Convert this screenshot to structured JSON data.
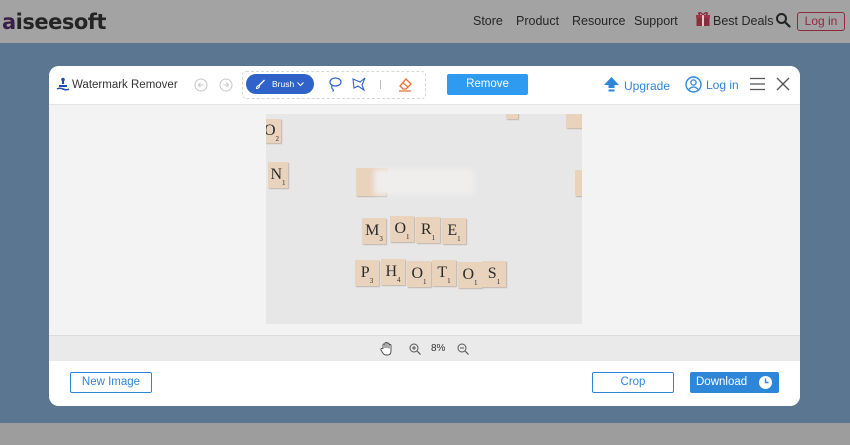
{
  "site": {
    "logo_initial": "a",
    "logo_rest": "iseesoft",
    "nav": [
      {
        "label": "Store"
      },
      {
        "label": "Product"
      },
      {
        "label": "Resource"
      },
      {
        "label": "Support"
      },
      {
        "label": "Best Deals"
      }
    ],
    "login_label": "Log in"
  },
  "modal": {
    "title": "Watermark Remover",
    "brush_label": "Brush",
    "remove_label": "Remove",
    "upgrade_label": "Upgrade",
    "login_label": "Log in",
    "zoom": "8%",
    "new_image_label": "New Image",
    "crop_label": "Crop",
    "download_label": "Download"
  },
  "photo": {
    "row1": [
      {
        "letter": "M",
        "sub": "3"
      },
      {
        "letter": "O",
        "sub": "1"
      },
      {
        "letter": "R",
        "sub": "1"
      },
      {
        "letter": "E",
        "sub": "1"
      }
    ],
    "row2": [
      {
        "letter": "P",
        "sub": "3"
      },
      {
        "letter": "H",
        "sub": "4"
      },
      {
        "letter": "O",
        "sub": "1"
      },
      {
        "letter": "T",
        "sub": "1"
      },
      {
        "letter": "O",
        "sub": "1"
      },
      {
        "letter": "S",
        "sub": "1"
      }
    ],
    "edge_tiles": [
      {
        "letter": "O",
        "sub": "2"
      },
      {
        "letter": "N",
        "sub": "1"
      }
    ]
  },
  "colors": {
    "accent_blue": "#2e86d8",
    "brush_blue": "#2f63c9",
    "remove_blue": "#2e9bf0",
    "login_red": "#8b2c3e",
    "tile": "#e9d3bd"
  },
  "icons": [
    "gift-icon",
    "search-icon",
    "watermark-app-icon",
    "undo-icon",
    "redo-icon",
    "brush-icon",
    "lasso-icon",
    "polygon-lasso-icon",
    "eraser-icon",
    "upgrade-icon",
    "user-icon",
    "menu-icon",
    "close-icon",
    "hand-icon",
    "zoom-in-icon",
    "zoom-out-icon",
    "clock-icon"
  ]
}
